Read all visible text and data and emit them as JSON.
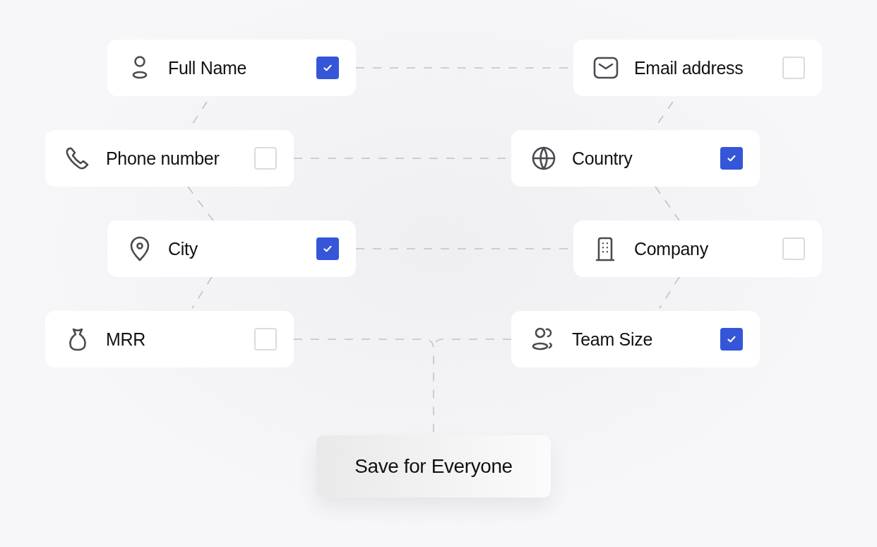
{
  "fields": [
    {
      "label": "Full Name",
      "checked": true
    },
    {
      "label": "Email address",
      "checked": false
    },
    {
      "label": "Phone number",
      "checked": false
    },
    {
      "label": "Country",
      "checked": true
    },
    {
      "label": "City",
      "checked": true
    },
    {
      "label": "Company",
      "checked": false
    },
    {
      "label": "MRR",
      "checked": false
    },
    {
      "label": "Team Size",
      "checked": true
    }
  ],
  "save_button": {
    "label": "Save for Everyone"
  }
}
